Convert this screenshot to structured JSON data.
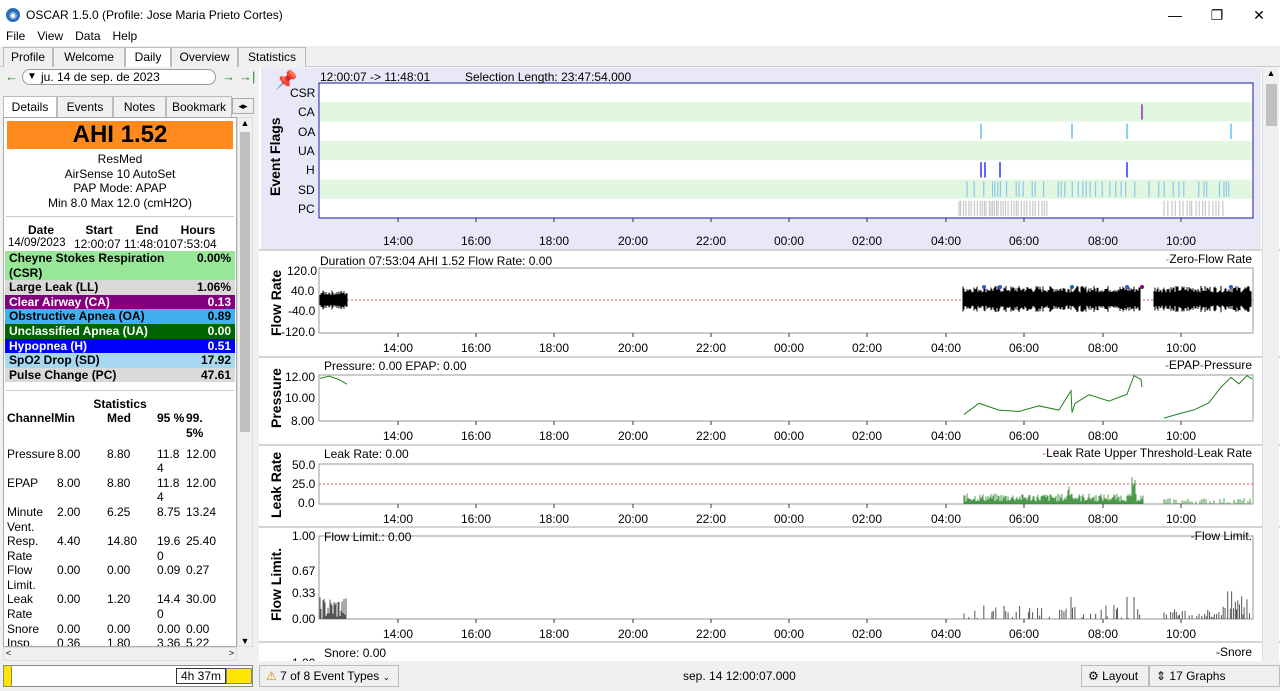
{
  "window": {
    "title": "OSCAR 1.5.0 (Profile: Jose Maria Prieto Cortes)",
    "app_icon_glyph": "◉"
  },
  "menu": [
    "File",
    "View",
    "Data",
    "Help"
  ],
  "tabs": [
    "Profile",
    "Welcome",
    "Daily",
    "Overview",
    "Statistics"
  ],
  "date": {
    "value": "ju. 14 de sep. de 2023"
  },
  "left_tabs": [
    "Details",
    "Events",
    "Notes",
    "Bookmark"
  ],
  "summary": {
    "ahi": "AHI  1.52",
    "brand": "ResMed",
    "model": "AirSense 10 AutoSet",
    "mode": "PAP Mode: APAP",
    "pressure": "Min 8.0 Max 12.0 (cmH2O)"
  },
  "session": {
    "headers": [
      "Date",
      "Start",
      "End",
      "Hours"
    ],
    "values": [
      "14/09/2023",
      "12:00:07",
      "11:48:01",
      "07:53:04"
    ]
  },
  "events": [
    {
      "label": "Cheyne Stokes Respiration",
      "label2": "(CSR)",
      "value": "0.00%",
      "color": "#98e698"
    },
    {
      "label": "Large Leak (LL)",
      "value": "1.06%",
      "color": "#d9d9d9"
    },
    {
      "label": "Clear Airway (CA)",
      "value": "0.13",
      "color": "#800080",
      "text": "#fff"
    },
    {
      "label": "Obstructive Apnea (OA)",
      "value": "0.89",
      "color": "#40b0f0"
    },
    {
      "label": "Unclassified Apnea (UA)",
      "value": "0.00",
      "color": "#006400",
      "text": "#fff"
    },
    {
      "label": "Hypopnea (H)",
      "value": "0.51",
      "color": "#0000ff",
      "text": "#fff"
    },
    {
      "label": "SpO2 Drop (SD)",
      "value": "17.92",
      "color": "#a6d8f0"
    },
    {
      "label": "Pulse Change (PC)",
      "value": "47.61",
      "color": "#d9d9d9"
    }
  ],
  "statistics": {
    "title": "Statistics",
    "headers": [
      "ChannelMin",
      "Med",
      "95 %",
      "99.5%"
    ],
    "rows": [
      [
        "Pressure",
        "8.00",
        "8.80",
        "11.84",
        "12.00"
      ],
      [
        "EPAP",
        "8.00",
        "8.80",
        "11.84",
        "12.00"
      ],
      [
        "Minute Vent.",
        "2.00",
        "6.25",
        "8.75",
        "13.24"
      ],
      [
        "Resp. Rate",
        "4.40",
        "14.80",
        "19.60",
        "25.40"
      ],
      [
        "Flow Limit.",
        "0.00",
        "0.00",
        "0.09",
        "0.27"
      ],
      [
        "Leak Rate",
        "0.00",
        "1.20",
        "14.40",
        "30.00"
      ],
      [
        "Snore",
        "0.00",
        "0.00",
        "0.00",
        "0.00"
      ],
      [
        "Insp.",
        "0.36",
        "1.80",
        "3.36",
        "5.22"
      ]
    ]
  },
  "bottom_left": {
    "duration": "4h 37m"
  },
  "header_line": {
    "range": "12:00:07 -> 11:48:01",
    "selection": "Selection Length: 23:47:54.000"
  },
  "time_ticks": [
    "14:00",
    "16:00",
    "18:00",
    "20:00",
    "22:00",
    "00:00",
    "02:00",
    "04:00",
    "06:00",
    "08:00",
    "10:00"
  ],
  "graphs": {
    "event_flags": {
      "ylabel": "Event Flags",
      "rows": [
        "CSR",
        "CA",
        "OA",
        "UA",
        "H",
        "SD",
        "PC"
      ]
    },
    "flow_rate": {
      "ylabel": "Flow Rate",
      "info": "Duration 07:53:04 AHI 1.52 Flow Rate: 0.00",
      "legend": "Zero-Flow Rate",
      "yticks": [
        "120.0",
        "40.0",
        "-40.0",
        "-120.0"
      ]
    },
    "pressure": {
      "ylabel": "Pressure",
      "info": "Pressure: 0.00 EPAP: 0.00",
      "legend": "EPAP",
      "legend2": "Pressure",
      "yticks": [
        "12.00",
        "10.00",
        "8.00"
      ]
    },
    "leak_rate": {
      "ylabel": "Leak Rate",
      "info": "Leak Rate: 0.00",
      "legend": "Leak Rate Upper Threshold",
      "legend2": "Leak Rate",
      "yticks": [
        "50.0",
        "25.0",
        "0.0"
      ]
    },
    "flow_limit": {
      "ylabel": "Flow Limit.",
      "info": "Flow Limit.: 0.00",
      "legend": "Flow Limit.",
      "yticks": [
        "1.00",
        "0.67",
        "0.33",
        "0.00"
      ]
    },
    "snore": {
      "info": "Snore: 0.00",
      "legend": "Snore",
      "ytick": "1.00"
    }
  },
  "bottom": {
    "event_types": "7 of 8 Event Types",
    "datetime": "sep. 14 12:00:07.000",
    "layout": "Layout",
    "graphs": "17 Graphs"
  }
}
